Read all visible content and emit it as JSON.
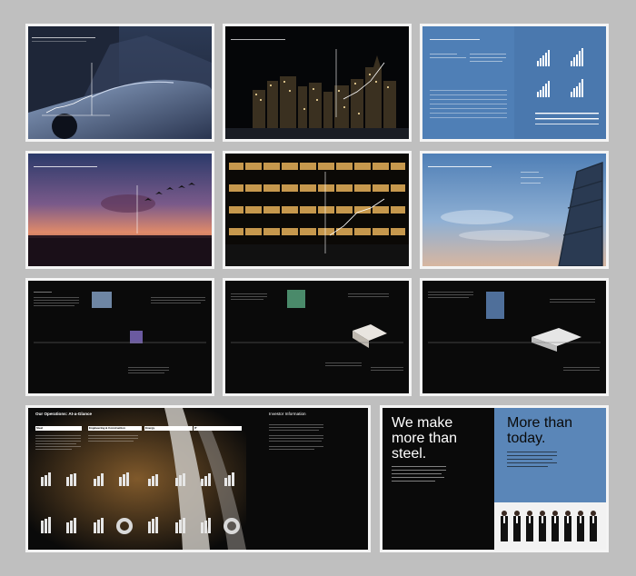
{
  "overview": {
    "title": "Our Operations: At-a-Glance",
    "headers": [
      "Steel",
      "Engineering & Construction",
      "Energy",
      "IT"
    ],
    "bottom_col_title": "Investor Information"
  },
  "back_cover": {
    "headline_left": [
      "We make",
      "more than",
      "steel."
    ],
    "headline_right": [
      "More than",
      "today."
    ]
  },
  "colors": {
    "background": "#bfbfbf",
    "black_page": "#0a0a0a",
    "blue_page": "#3e6ea5",
    "accent_white": "#ffffff"
  }
}
